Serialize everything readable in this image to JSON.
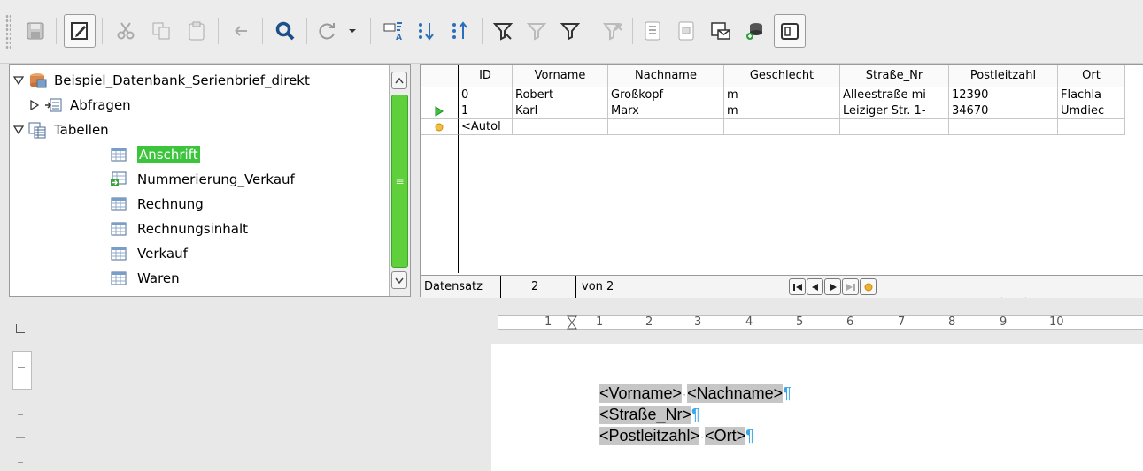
{
  "toolbar": {
    "buttons": [
      {
        "name": "save-icon"
      },
      {
        "name": "edit-mode-icon",
        "active": true
      },
      {
        "name": "cut-icon"
      },
      {
        "name": "copy-icon"
      },
      {
        "name": "paste-icon"
      },
      {
        "name": "undo-icon"
      },
      {
        "name": "search-icon"
      },
      {
        "name": "refresh-icon"
      },
      {
        "name": "sort-icon"
      },
      {
        "name": "sort-ascending-icon"
      },
      {
        "name": "sort-descending-icon"
      },
      {
        "name": "autofilter-icon"
      },
      {
        "name": "apply-filter-icon"
      },
      {
        "name": "standard-filter-icon"
      },
      {
        "name": "remove-filter-icon"
      },
      {
        "name": "data-to-text-icon"
      },
      {
        "name": "data-to-fields-icon"
      },
      {
        "name": "mail-merge-icon"
      },
      {
        "name": "data-source-icon"
      },
      {
        "name": "explorer-icon",
        "active": true
      }
    ]
  },
  "navigator": {
    "database": "Beispiel_Datenbank_Serienbrief_direkt",
    "queries": "Abfragen",
    "tables": "Tabellen",
    "table_items": [
      {
        "label": "Anschrift",
        "selected": true,
        "icon": "table-icon"
      },
      {
        "label": "Nummerierung_Verkauf",
        "selected": false,
        "icon": "view-icon"
      },
      {
        "label": "Rechnung",
        "selected": false,
        "icon": "table-icon"
      },
      {
        "label": "Rechnungsinhalt",
        "selected": false,
        "icon": "table-icon"
      },
      {
        "label": "Verkauf",
        "selected": false,
        "icon": "table-icon"
      },
      {
        "label": "Waren",
        "selected": false,
        "icon": "table-icon"
      }
    ],
    "scrollbar_grip": "≡"
  },
  "grid": {
    "columns": [
      "ID",
      "Vorname",
      "Nachname",
      "Geschlecht",
      "Straße_Nr",
      "Postleitzahl",
      "Ort"
    ],
    "rows": [
      {
        "cells": [
          "0",
          "Robert",
          "Großkopf",
          "m",
          "Alleestraße mi",
          "12390",
          "Flachla"
        ],
        "marker": ""
      },
      {
        "cells": [
          "1",
          "Karl",
          "Marx",
          "m",
          "Leiziger Str. 1-",
          "34670",
          "Umdiec"
        ],
        "marker": "current"
      },
      {
        "cells": [
          "<Autol",
          "",
          "",
          "",
          "",
          "",
          ""
        ],
        "marker": "new"
      }
    ],
    "navbar": {
      "label": "Datensatz",
      "current": "2",
      "of_total": "von 2"
    }
  },
  "document": {
    "ruler_numbers": [
      "1",
      "1",
      "2",
      "3",
      "4",
      "5",
      "6",
      "7",
      "8",
      "9",
      "10"
    ],
    "lines": [
      {
        "fields": [
          "<Vorname>",
          "<Nachname>"
        ],
        "pilcrow": "¶"
      },
      {
        "fields": [
          "<Straße_Nr>"
        ],
        "pilcrow": "¶"
      },
      {
        "fields": [
          "<Postleitzahl>",
          "<Ort>"
        ],
        "pilcrow": "¶"
      }
    ]
  }
}
